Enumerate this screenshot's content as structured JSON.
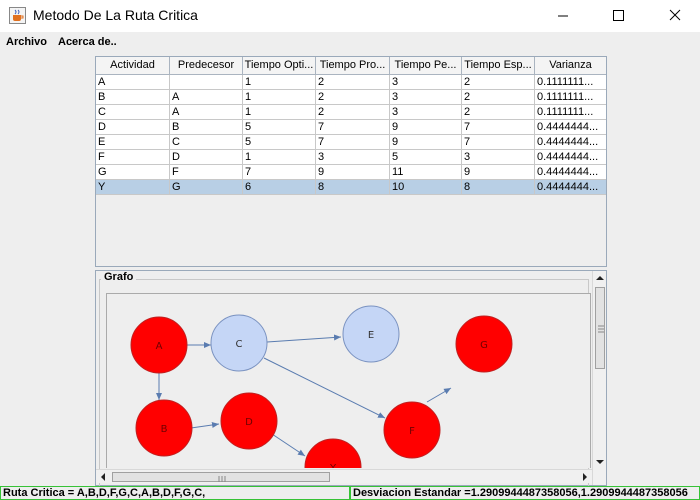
{
  "window": {
    "title": "Metodo De La Ruta Critica",
    "icon": "java-cup-icon"
  },
  "menu": {
    "items": [
      {
        "label": "Archivo"
      },
      {
        "label": "Acerca de.."
      }
    ]
  },
  "table": {
    "columns": [
      "Actividad",
      "Predecesor",
      "Tiempo Opti...",
      "Tiempo Pro...",
      "Tiempo Pe...",
      "Tiempo Esp...",
      "Varianza"
    ],
    "rows": [
      [
        "A",
        "",
        "1",
        "2",
        "3",
        "2",
        "0.1111111..."
      ],
      [
        "B",
        "A",
        "1",
        "2",
        "3",
        "2",
        "0.1111111..."
      ],
      [
        "C",
        "A",
        "1",
        "2",
        "3",
        "2",
        "0.1111111..."
      ],
      [
        "D",
        "B",
        "5",
        "7",
        "9",
        "7",
        "0.4444444..."
      ],
      [
        "E",
        "C",
        "5",
        "7",
        "9",
        "7",
        "0.4444444..."
      ],
      [
        "F",
        "D",
        "1",
        "3",
        "5",
        "3",
        "0.4444444..."
      ],
      [
        "G",
        "F",
        "7",
        "9",
        "11",
        "9",
        "0.4444444..."
      ],
      [
        "Y",
        "G",
        "6",
        "8",
        "10",
        "8",
        "0.4444444..."
      ]
    ],
    "selected_row": 7,
    "selected_color": "#b8cfe5"
  },
  "grafo": {
    "title": "Grafo",
    "critical_color": "#ff0000",
    "normal_color": "#c5d6f6",
    "nodes": [
      {
        "label": "A",
        "critical": true
      },
      {
        "label": "C",
        "critical": false
      },
      {
        "label": "E",
        "critical": false
      },
      {
        "label": "G",
        "critical": true
      },
      {
        "label": "B",
        "critical": true
      },
      {
        "label": "D",
        "critical": true
      },
      {
        "label": "F",
        "critical": true
      },
      {
        "label": "Y",
        "critical": true
      }
    ]
  },
  "status": {
    "ruta_critica": "Ruta Critica = A,B,D,F,G,C,A,B,D,F,G,C,",
    "desviacion": "Desviacion Estandar =1.2909944487358056,1.2909944487358056"
  }
}
